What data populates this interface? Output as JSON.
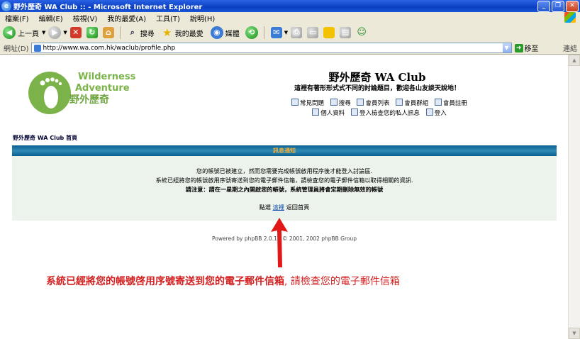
{
  "window": {
    "title": "野外歷奇 WA Club :: - Microsoft Internet Explorer"
  },
  "menu": [
    "檔案(F)",
    "編輯(E)",
    "檢視(V)",
    "我的最愛(A)",
    "工具(T)",
    "說明(H)"
  ],
  "toolbar": {
    "back_label": "上一頁",
    "search_label": "搜尋",
    "favorites_label": "我的最愛",
    "media_label": "媒體"
  },
  "address": {
    "label": "網址(D)",
    "url": "http://www.wa.com.hk/waclub/profile.php",
    "go_label": "移至",
    "links_label": "連結"
  },
  "site": {
    "logo_line1": "Wilderness",
    "logo_line2": "Adventure",
    "logo_line3": "野外歷奇",
    "title": "野外歷奇 WA Club",
    "description": "這裡有著形形式式不同的討論題目，歡迎各山友談天說地！"
  },
  "nav": {
    "faq": "常見問題",
    "search": "搜尋",
    "memberlist": "會員列表",
    "groups": "會員群組",
    "register": "會員註冊",
    "profile": "個人資料",
    "pm": "登入檢查您的私人訊息",
    "login": "登入"
  },
  "breadcrumb": "野外歷奇 WA Club 首頁",
  "panel": {
    "header": "訊息通知",
    "line1": "您的帳號已被建立，然而您需要完成帳號啟用程序後才能登入討論區.",
    "line2": "系統已經將您的帳號啟用序號寄送到您的電子郵件信箱，請檢查您的電子郵件信箱以取得相關的資訊.",
    "line3": "請注意：請在一星期之內開啟您的帳號，系統管理員將會定期刪除無效的帳號",
    "back_prefix": "點選",
    "back_link": "這裡",
    "back_suffix": "返回首頁"
  },
  "footer": "Powered by phpBB 2.0.11 © 2001, 2002 phpBB Group",
  "annotation": {
    "part1": "系統已經將您的帳號啓用序號寄送到您的電子郵件信箱",
    "part2": ", 請檢查您的電子郵件信箱"
  },
  "colors": {
    "accent_red": "#d22020",
    "panel_bg": "#ecf3ec",
    "panel_head": "#0a5f8f",
    "logo_green": "#7bb34a"
  }
}
